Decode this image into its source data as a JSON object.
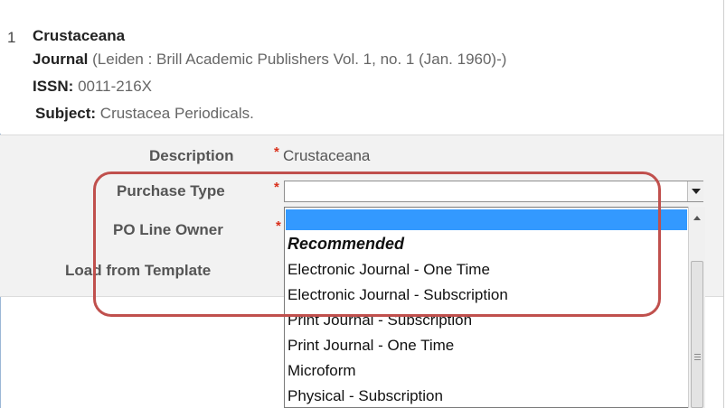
{
  "record": {
    "index": "1",
    "title": "Crustaceana",
    "type_label": "Journal",
    "type_detail": " (Leiden : Brill Academic Publishers Vol. 1, no. 1 (Jan. 1960)-)",
    "issn_label": "ISSN:",
    "issn_value": " 0011-216X",
    "subject_label": "Subject:",
    "subject_value": " Crustacea Periodicals."
  },
  "form": {
    "description_label": "Description",
    "description_value": "Crustaceana",
    "purchase_type_label": "Purchase Type",
    "purchase_type_value": "",
    "po_line_owner_label": "PO Line Owner",
    "load_template_label": "Load from Template",
    "required_mark": "*"
  },
  "dropdown": {
    "group_label": "Recommended",
    "options": [
      "Electronic Journal - One Time",
      "Electronic Journal - Subscription",
      "Print Journal - Subscription",
      "Print Journal - One Time",
      "Microform",
      "Physical - Subscription"
    ]
  },
  "colors": {
    "required": "#d9301c",
    "highlight": "#c0504d",
    "selection": "#3399ff"
  },
  "icons": {
    "select_arrow": "chevron-down-icon",
    "scroll_up": "arrow-up-icon"
  }
}
